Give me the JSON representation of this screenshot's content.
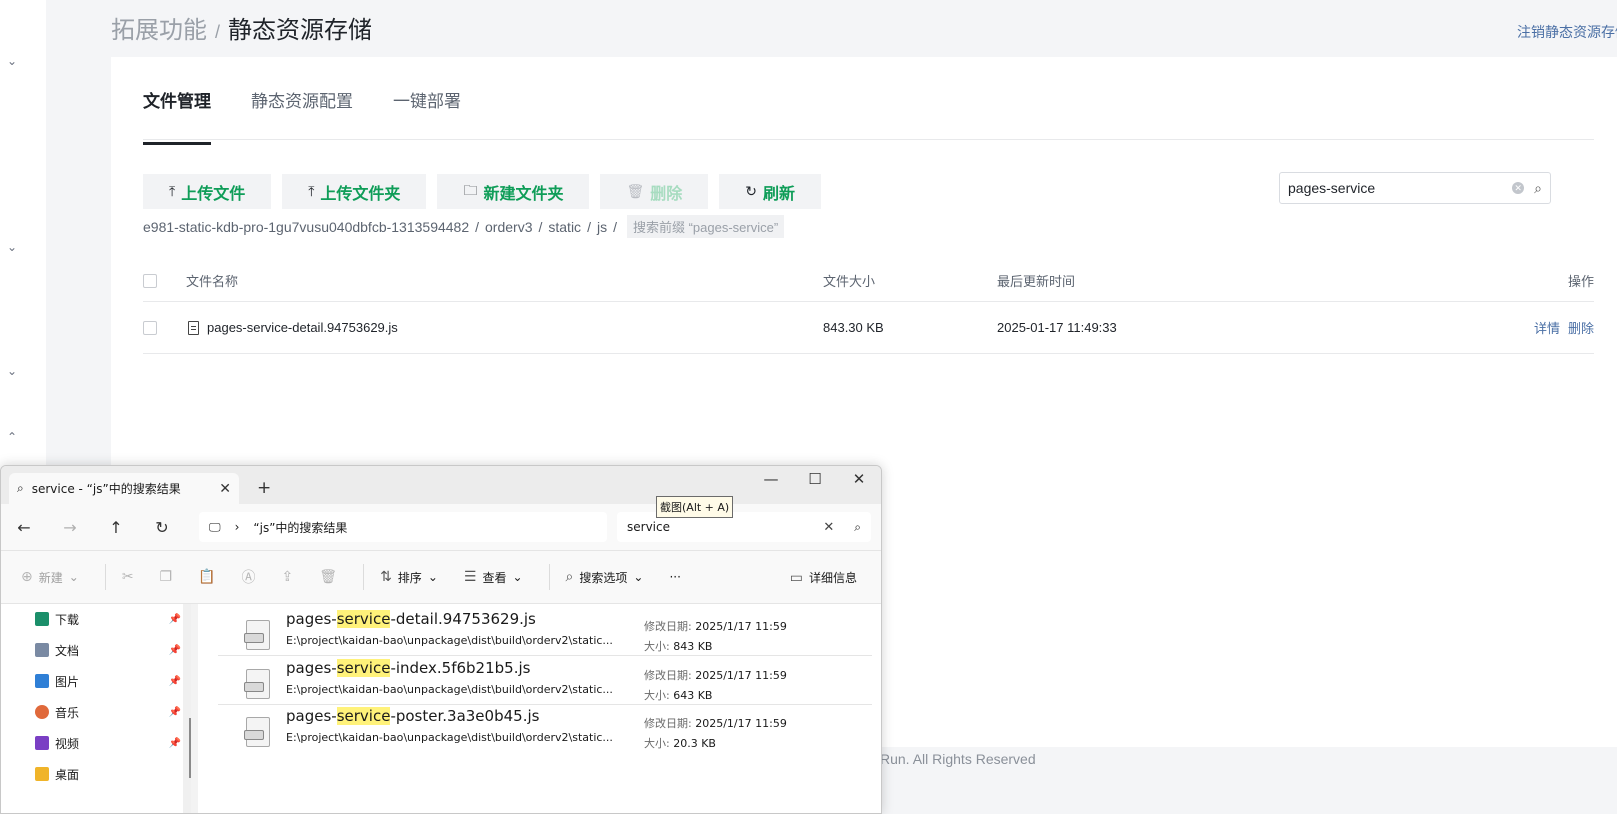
{
  "header": {
    "crumb_parent": "拓展功能",
    "crumb_sep": "/",
    "crumb_current": "静态资源存储",
    "logout_link": "注销静态资源存储"
  },
  "tabs": [
    {
      "label": "文件管理",
      "active": true
    },
    {
      "label": "静态资源配置",
      "active": false
    },
    {
      "label": "一键部署",
      "active": false
    }
  ],
  "toolbar": {
    "upload_file": "上传文件",
    "upload_folder": "上传文件夹",
    "new_folder": "新建文件夹",
    "delete": "删除",
    "refresh": "刷新"
  },
  "search": {
    "value": "pages-service"
  },
  "path": {
    "segments": [
      "e981-static-kdb-pro-1gu7vusu040dbfcb-1313594482",
      "orderv3",
      "static",
      "js"
    ],
    "separator": "/",
    "filter_pill": "搜索前缀 “pages-service”"
  },
  "table": {
    "headers": {
      "name": "文件名称",
      "size": "文件大小",
      "updated": "最后更新时间",
      "ops": "操作"
    },
    "rows": [
      {
        "name": "pages-service-detail.94753629.js",
        "size": "843.30 KB",
        "updated": "2025-01-17 11:49:33",
        "op_detail": "详情",
        "op_delete": "删除"
      }
    ]
  },
  "footer": {
    "text": "Run. All Rights Reserved"
  },
  "explorer": {
    "tab_title": "service - “js”中的搜索结果",
    "address": "“js”中的搜索结果",
    "search_value": "service",
    "commands": {
      "new": "新建",
      "sort": "排序",
      "view": "查看",
      "search_options": "搜索选项",
      "more": "···",
      "details": "详细信息"
    },
    "nav_items": [
      {
        "label": "下载",
        "color": "#1b8f6a"
      },
      {
        "label": "文档",
        "color": "#7a8aa3"
      },
      {
        "label": "图片",
        "color": "#2f7fd6"
      },
      {
        "label": "音乐",
        "color": "#e0693b"
      },
      {
        "label": "视频",
        "color": "#7a3fc4"
      },
      {
        "label": "桌面",
        "color": "#f0b429"
      }
    ],
    "results": [
      {
        "pre": "pages-",
        "hl": "service",
        "post": "-detail.94753629.js",
        "location": "E:\\project\\kaidan-bao\\unpackage\\dist\\build\\orderv2\\static...",
        "date_label": "修改日期:",
        "date": "2025/1/17 11:59",
        "size_label": "大小:",
        "size": "843 KB"
      },
      {
        "pre": "pages-",
        "hl": "service",
        "post": "-index.5f6b21b5.js",
        "location": "E:\\project\\kaidan-bao\\unpackage\\dist\\build\\orderv2\\static...",
        "date_label": "修改日期:",
        "date": "2025/1/17 11:59",
        "size_label": "大小:",
        "size": "643 KB"
      },
      {
        "pre": "pages-",
        "hl": "service",
        "post": "-poster.3a3e0b45.js",
        "location": "E:\\project\\kaidan-bao\\unpackage\\dist\\build\\orderv2\\static...",
        "date_label": "修改日期:",
        "date": "2025/1/17 11:59",
        "size_label": "大小:",
        "size": "20.3 KB"
      }
    ]
  },
  "tooltip": {
    "text": "截图(Alt + A)"
  }
}
